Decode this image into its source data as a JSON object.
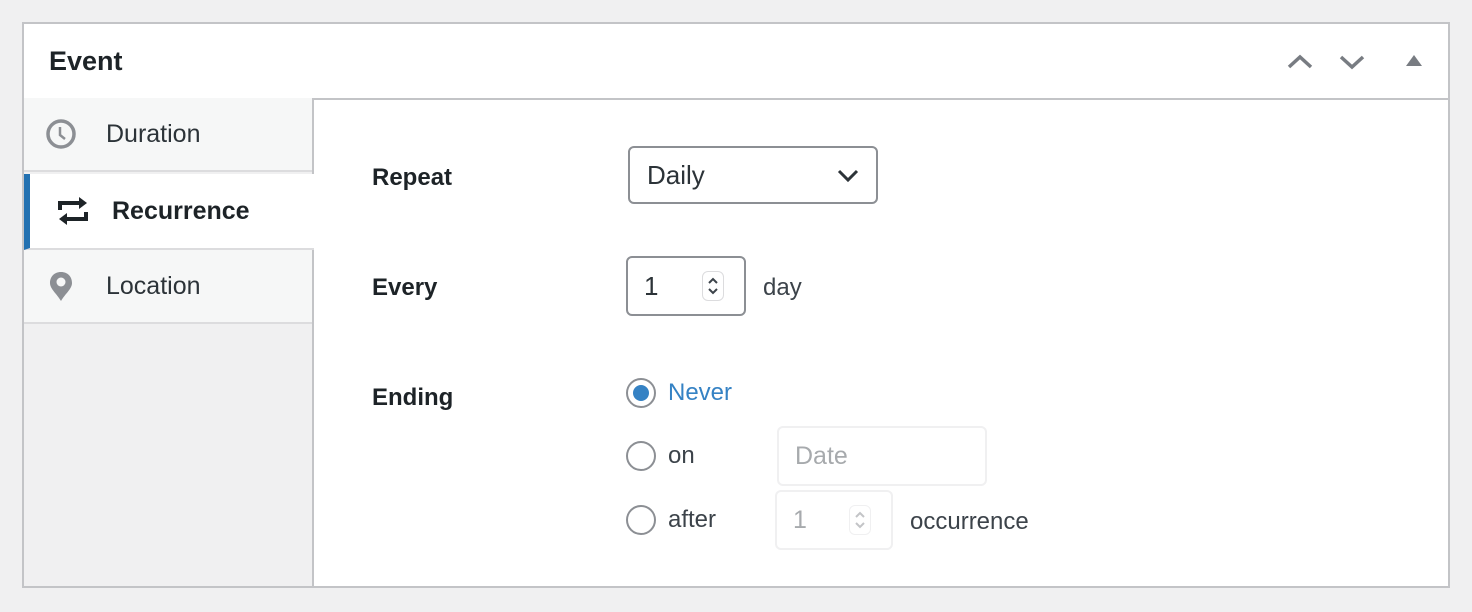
{
  "panel": {
    "title": "Event",
    "controls": [
      "move-up",
      "move-down",
      "collapse"
    ]
  },
  "tabs": [
    {
      "label": "Duration",
      "icon": "clock-icon",
      "active": false
    },
    {
      "label": "Recurrence",
      "icon": "repeat-icon",
      "active": true
    },
    {
      "label": "Location",
      "icon": "location-pin-icon",
      "active": false
    }
  ],
  "form": {
    "repeat": {
      "label": "Repeat",
      "value": "Daily"
    },
    "every": {
      "label": "Every",
      "value": "1",
      "unit": "day"
    },
    "ending": {
      "label": "Ending",
      "options": [
        {
          "label": "Never",
          "checked": true
        },
        {
          "label": "on",
          "checked": false
        },
        {
          "label": "after",
          "checked": false
        }
      ],
      "date_placeholder": "Date",
      "occurrence_value": "1",
      "occurrence_unit": "occurrence"
    }
  },
  "colors": {
    "accent": "#2271b1",
    "radio": "#3582c4",
    "border": "#c3c4c7"
  }
}
